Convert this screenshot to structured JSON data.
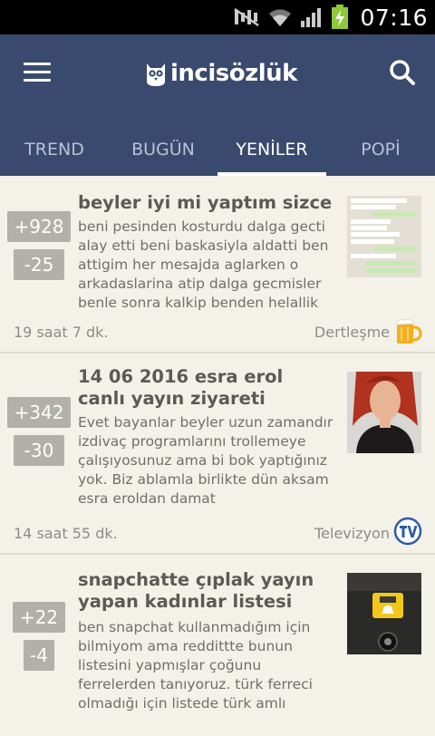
{
  "status_bar": {
    "time": "07:16"
  },
  "app": {
    "logo_text": "incisözlük"
  },
  "tabs": [
    {
      "label": "TREND"
    },
    {
      "label": "BUGÜN"
    },
    {
      "label": "YENİLER",
      "active": true
    },
    {
      "label": "POPİ"
    }
  ],
  "entries": [
    {
      "title": "beyler iyi mi yaptım sizce",
      "snippet": "beni pesinden kosturdu dalga gecti alay etti beni baskasiyla aldatti ben attigim her mesajda aglarken o arkadaslarina atip dalga gecmisler benle sonra kalkip benden helallik",
      "upvotes": "+928",
      "downvotes": "-25",
      "time": "19 saat 7 dk.",
      "category": "Dertleşme",
      "category_icon": "beer-mug-icon",
      "thumbnail": "chat-screenshot"
    },
    {
      "title": "14 06 2016 esra erol canlı yayın ziyareti",
      "snippet": "Evet bayanlar beyler uzun zamandır izdivaç programlarını trollemeye çalışıyosunuz ama bi bok yaptığınız yok. Biz ablamla birlikte dün aksam esra eroldan damat",
      "upvotes": "+342",
      "downvotes": "-30",
      "time": "14 saat 55 dk.",
      "category": "Televizyon",
      "category_icon": "tv-badge-icon",
      "thumbnail": "woman-portrait"
    },
    {
      "title": "snapchatte çıplak yayın yapan kadınlar listesi",
      "snippet": "ben snapchat kullanmadığım için bilmiyom ama reddittte bunun listesini yapmışlar çoğunu ferrelerden tanıyoruz. türk ferreci olmadığı için listede türk amlı",
      "upvotes": "+22",
      "downvotes": "-4",
      "thumbnail": "snapchat-button-photo"
    }
  ],
  "colors": {
    "appbar": "#3a4a6e",
    "background": "#f3f1e8",
    "vote_badge": "#b1b0ab",
    "title_text": "#5b5a55"
  }
}
